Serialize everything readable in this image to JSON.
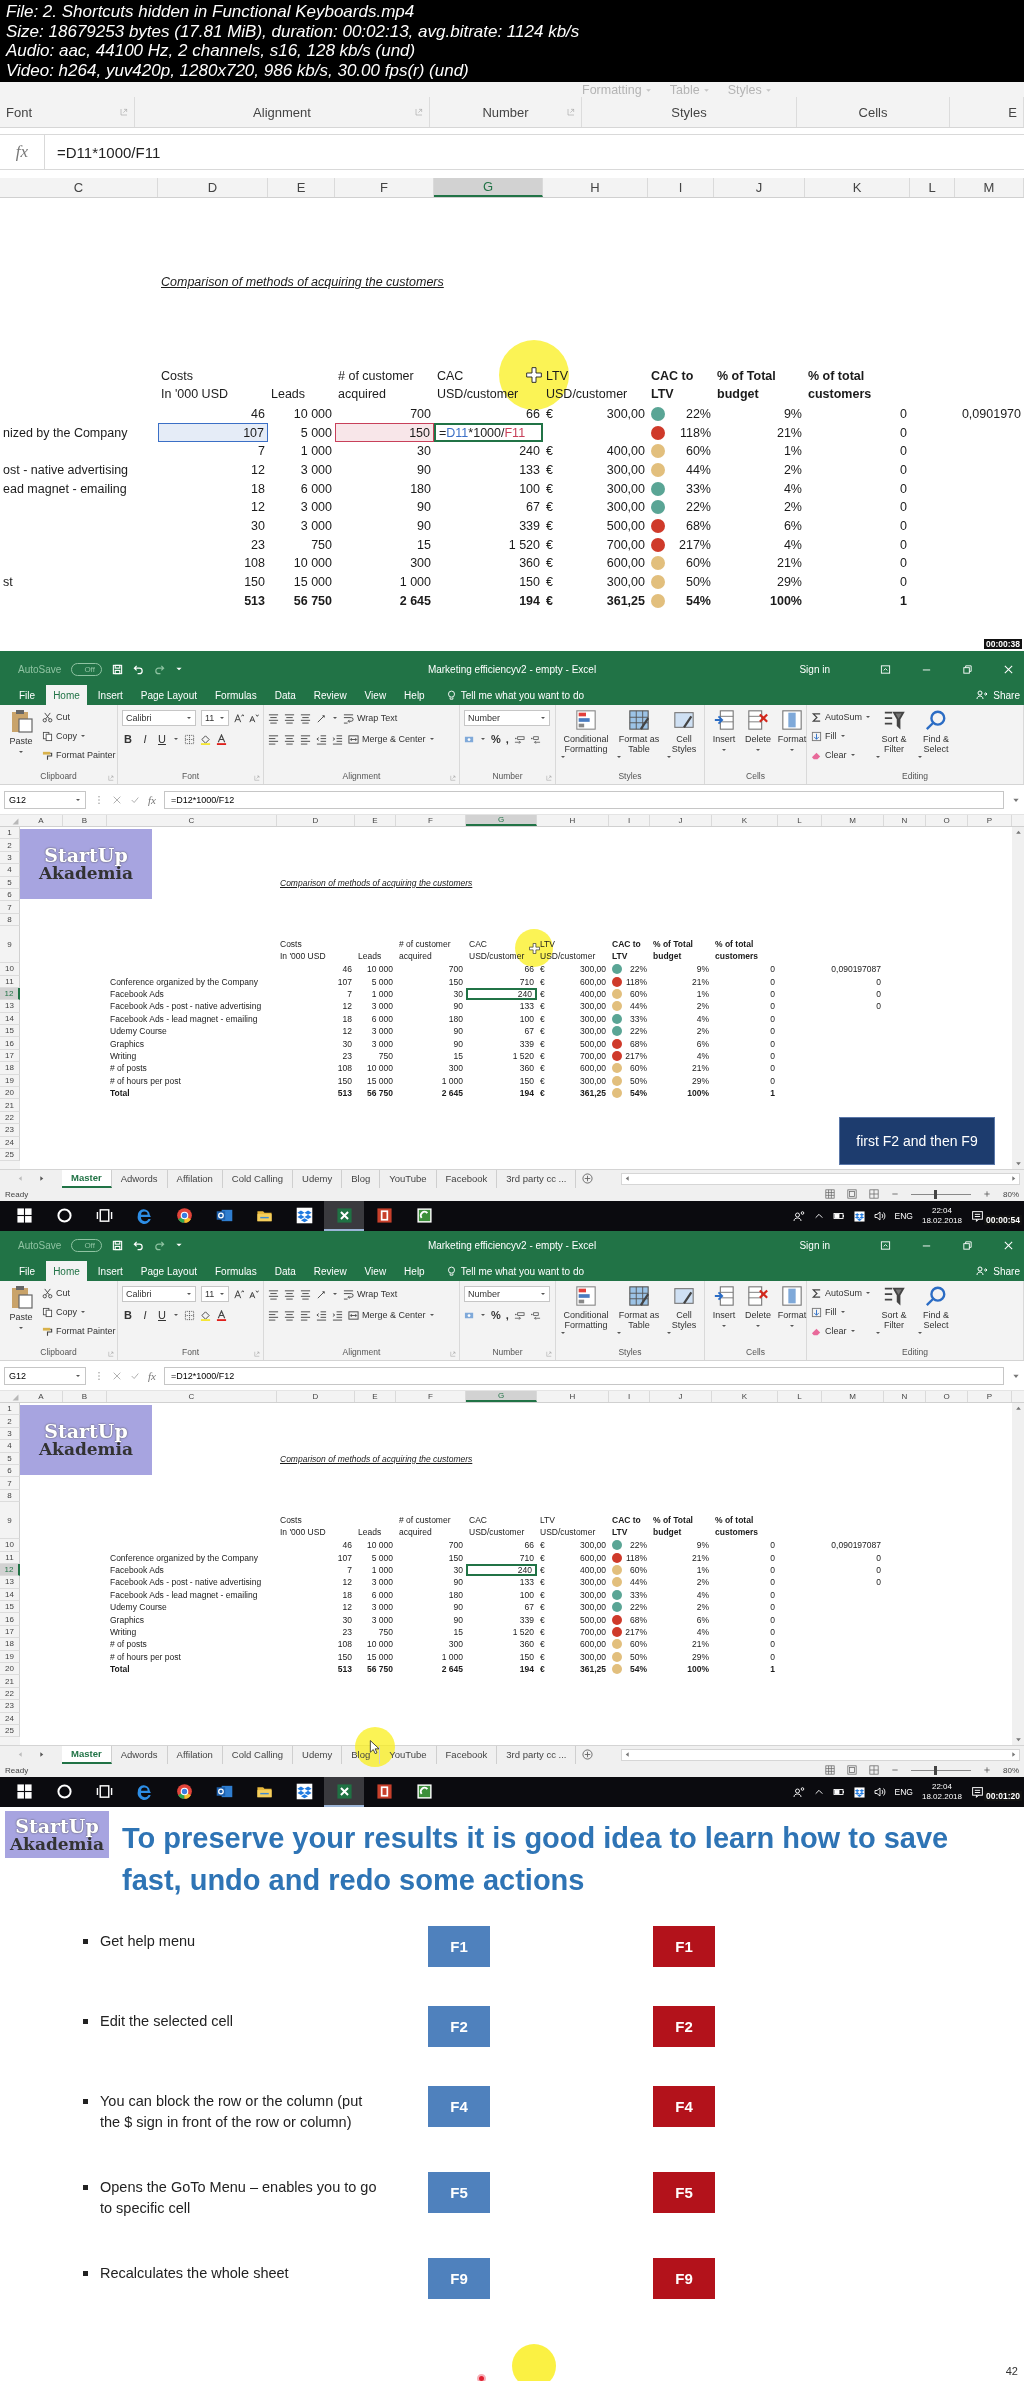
{
  "video_info": [
    "File: 2. Shortcuts hidden in Functional Keyboards.mp4",
    "Size: 18679253 bytes (17.81 MiB), duration: 00:02:13, avg.bitrate: 1124 kb/s",
    "Audio: aac, 44100 Hz, 2 channels, s16, 128 kb/s (und)",
    "Video: h264, yuv420p, 1280x720, 986 kb/s, 30.00 fps(r) (und)"
  ],
  "zoomed_frame": {
    "ribbon_top": [
      "Formatting",
      "Table",
      "Styles"
    ],
    "ribbon_groups": [
      "Font",
      "Alignment",
      "Number",
      "Styles",
      "Cells",
      "E"
    ],
    "formula_label": "fx",
    "formula": "=D11*1000/F11",
    "sheet": {
      "columns": [
        {
          "label": "C",
          "selected": false
        },
        {
          "label": "D",
          "selected": false
        },
        {
          "label": "E",
          "selected": false
        },
        {
          "label": "F",
          "selected": false
        },
        {
          "label": "G",
          "selected": true
        },
        {
          "label": "H",
          "selected": false
        },
        {
          "label": "I",
          "selected": false
        },
        {
          "label": "J",
          "selected": false
        },
        {
          "label": "K",
          "selected": false
        },
        {
          "label": "L",
          "selected": false
        },
        {
          "label": "M",
          "selected": false
        }
      ],
      "title": "Comparison of methods of acquiring the customers",
      "headers": {
        "D": {
          "lines": [
            "Costs",
            "In '000 USD"
          ],
          "bold": false
        },
        "E": {
          "lines": [
            "Leads"
          ],
          "bold": false
        },
        "F": {
          "lines": [
            "# of customer",
            "acquired"
          ],
          "bold": false
        },
        "G": {
          "lines": [
            "CAC",
            "USD/customer"
          ],
          "bold": false
        },
        "H": {
          "lines": [
            "LTV",
            "USD/customer"
          ],
          "bold": false
        },
        "I": {
          "lines": [
            "CAC to",
            "LTV"
          ],
          "bold": true
        },
        "J": {
          "lines": [
            "% of Total",
            "budget"
          ],
          "bold": true
        },
        "K": {
          "lines": [
            "% of total",
            "customers"
          ],
          "bold": true
        }
      },
      "rows": [
        {
          "kind": "data",
          "cells": {
            "D": "46",
            "E": "10 000",
            "F": "700",
            "G": "66",
            "H": "300,00",
            "I": "22%",
            "J": "9%",
            "K": "0",
            "M": "0,0901970"
          },
          "currency": "€",
          "color": "#5aa595"
        },
        {
          "kind": "data",
          "label": "nized by the Company",
          "cells": {
            "D": "107",
            "E": "5 000",
            "F": "150",
            "I": "118%",
            "J": "21%",
            "K": "0"
          },
          "color": "#cf3a2a",
          "selection": {
            "G": true
          },
          "ref_cells": {
            "D": {
              "color": "#3b6fc6"
            },
            "F": {
              "color": "#c8405a"
            }
          },
          "formula_edit": [
            {
              "text": "=",
              "color": "#222222"
            },
            {
              "text": "D11",
              "color": "#3b6fc6"
            },
            {
              "text": "*1000/",
              "color": "#222222"
            },
            {
              "text": "F11",
              "color": "#c8405a"
            }
          ]
        },
        {
          "kind": "data",
          "cells": {
            "D": "7",
            "E": "1 000",
            "F": "30",
            "G": "240",
            "H": "400,00",
            "I": "60%",
            "J": "1%",
            "K": "0"
          },
          "currency": "€",
          "color": "#e2bf7d"
        },
        {
          "kind": "data",
          "label": "ost - native advertising",
          "cells": {
            "D": "12",
            "E": "3 000",
            "F": "90",
            "G": "133",
            "H": "300,00",
            "I": "44%",
            "J": "2%",
            "K": "0"
          },
          "currency": "€",
          "color": "#e2bf7d"
        },
        {
          "kind": "data",
          "label": "ead magnet - emailing",
          "cells": {
            "D": "18",
            "E": "6 000",
            "F": "180",
            "G": "100",
            "H": "300,00",
            "I": "33%",
            "J": "4%",
            "K": "0"
          },
          "currency": "€",
          "color": "#5aa595"
        },
        {
          "kind": "data",
          "cells": {
            "D": "12",
            "E": "3 000",
            "F": "90",
            "G": "67",
            "H": "300,00",
            "I": "22%",
            "J": "2%",
            "K": "0"
          },
          "currency": "€",
          "color": "#5aa595"
        },
        {
          "kind": "data",
          "cells": {
            "D": "30",
            "E": "3 000",
            "F": "90",
            "G": "339",
            "H": "500,00",
            "I": "68%",
            "J": "6%",
            "K": "0"
          },
          "currency": "€",
          "color": "#cf3a2a"
        },
        {
          "kind": "data",
          "cells": {
            "D": "23",
            "E": "750",
            "F": "15",
            "G": "1 520",
            "H": "700,00",
            "I": "217%",
            "J": "4%",
            "K": "0"
          },
          "currency": "€",
          "color": "#cf3a2a"
        },
        {
          "kind": "data",
          "cells": {
            "D": "108",
            "E": "10 000",
            "F": "300",
            "G": "360",
            "H": "600,00",
            "I": "60%",
            "J": "21%",
            "K": "0"
          },
          "currency": "€",
          "color": "#e2bf7d"
        },
        {
          "kind": "data",
          "label": "st",
          "cells": {
            "D": "150",
            "E": "15 000",
            "F": "1 000",
            "G": "150",
            "H": "300,00",
            "I": "50%",
            "J": "29%",
            "K": "0"
          },
          "currency": "€",
          "color": "#e2bf7d"
        },
        {
          "kind": "total",
          "cells": {
            "D": "513",
            "E": "56 750",
            "F": "2 645",
            "G": "194",
            "H": "361,25",
            "I": "54%",
            "J": "100%",
            "K": "1"
          },
          "currency": "€",
          "color": "#e2bf7d"
        }
      ]
    },
    "cursor": {
      "kind": "cross"
    },
    "timestamp": "00:00:38"
  },
  "excel_frames": [
    {
      "autosave": "AutoSave",
      "autosave_state": "Off",
      "title": "Marketing efficiencyv2 - empty - Excel",
      "sign_in": "Sign in",
      "tabs": [
        {
          "label": "File",
          "selected": false
        },
        {
          "label": "Home",
          "selected": true
        },
        {
          "label": "Insert",
          "selected": false
        },
        {
          "label": "Page Layout",
          "selected": false
        },
        {
          "label": "Formulas",
          "selected": false
        },
        {
          "label": "Data",
          "selected": false
        },
        {
          "label": "Review",
          "selected": false
        },
        {
          "label": "View",
          "selected": false
        },
        {
          "label": "Help",
          "selected": false
        }
      ],
      "tell_me": "Tell me what you want to do",
      "share": "Share",
      "ribbon": [
        {
          "kind": "clipboard",
          "label": "Clipboard",
          "big": "Paste",
          "small": [
            "Cut",
            "Copy",
            "Format Painter"
          ]
        },
        {
          "kind": "font",
          "label": "Font",
          "font": "Calibri",
          "size": "11",
          "styles": [
            "B",
            "I",
            "U"
          ]
        },
        {
          "kind": "alignment",
          "label": "Alignment",
          "buttons": [
            "Wrap Text",
            "Merge & Center"
          ]
        },
        {
          "kind": "number",
          "label": "Number",
          "format": "Number",
          "symbols": [
            "%",
            ","
          ]
        },
        {
          "kind": "styles",
          "label": "Styles",
          "big": [
            "Conditional Formatting",
            "Format as Table",
            "Cell Styles"
          ]
        },
        {
          "kind": "cells",
          "label": "Cells",
          "big": [
            "Insert",
            "Delete",
            "Format"
          ]
        },
        {
          "kind": "editing",
          "label": "Editing",
          "small": [
            "AutoSum",
            "Fill",
            "Clear"
          ],
          "big": [
            "Sort & Filter",
            "Find & Select"
          ]
        }
      ],
      "name_box": "G12",
      "formula_label": "fx",
      "formula": "=D12*1000/F12",
      "sheet": {
        "columns": [
          {
            "label": "A",
            "selected": false
          },
          {
            "label": "B",
            "selected": false
          },
          {
            "label": "C",
            "selected": false
          },
          {
            "label": "D",
            "selected": false
          },
          {
            "label": "E",
            "selected": false
          },
          {
            "label": "F",
            "selected": false
          },
          {
            "label": "G",
            "selected": true
          },
          {
            "label": "H",
            "selected": false
          },
          {
            "label": "I",
            "selected": false
          },
          {
            "label": "J",
            "selected": false
          },
          {
            "label": "K",
            "selected": false
          },
          {
            "label": "L",
            "selected": false
          },
          {
            "label": "M",
            "selected": false
          },
          {
            "label": "N",
            "selected": false
          },
          {
            "label": "O",
            "selected": false
          },
          {
            "label": "P",
            "selected": false
          }
        ],
        "row_numbers": [
          {
            "label": "1",
            "selected": false
          },
          {
            "label": "2",
            "selected": false
          },
          {
            "label": "3",
            "selected": false
          },
          {
            "label": "4",
            "selected": false
          },
          {
            "label": "5",
            "selected": false
          },
          {
            "label": "6",
            "selected": false
          },
          {
            "label": "7",
            "selected": false
          },
          {
            "label": "8",
            "selected": false
          },
          {
            "label": "9",
            "selected": false
          },
          {
            "label": "10",
            "selected": false
          },
          {
            "label": "11",
            "selected": false
          },
          {
            "label": "12",
            "selected": true
          },
          {
            "label": "13",
            "selected": false
          },
          {
            "label": "14",
            "selected": false
          },
          {
            "label": "15",
            "selected": false
          },
          {
            "label": "16",
            "selected": false
          },
          {
            "label": "17",
            "selected": false
          },
          {
            "label": "18",
            "selected": false
          },
          {
            "label": "19",
            "selected": false
          },
          {
            "label": "20",
            "selected": false
          },
          {
            "label": "21",
            "selected": false
          },
          {
            "label": "22",
            "selected": false
          },
          {
            "label": "23",
            "selected": false
          },
          {
            "label": "24",
            "selected": false
          },
          {
            "label": "25",
            "selected": false
          }
        ],
        "logo": [
          "StartUp",
          "Akademia"
        ],
        "title": "Comparison of methods of acquiring the customers",
        "headers": {
          "D": {
            "lines": [
              "Costs",
              "In '000 USD"
            ],
            "bold": false
          },
          "E": {
            "lines": [
              "Leads"
            ],
            "bold": false
          },
          "F": {
            "lines": [
              "# of customer",
              "acquired"
            ],
            "bold": false
          },
          "G": {
            "lines": [
              "CAC",
              "USD/customer"
            ],
            "bold": false
          },
          "H": {
            "lines": [
              "LTV",
              "USD/customer"
            ],
            "bold": false
          },
          "I": {
            "lines": [
              "CAC to",
              "LTV"
            ],
            "bold": true
          },
          "J": {
            "lines": [
              "% of Total",
              "budget"
            ],
            "bold": true
          },
          "K": {
            "lines": [
              "% of total",
              "customers"
            ],
            "bold": true
          }
        },
        "rows": [
          {
            "kind": "data",
            "cells": {
              "D": "46",
              "E": "10 000",
              "F": "700",
              "G": "66",
              "H": "300,00",
              "I": "22%",
              "J": "9%",
              "K": "0",
              "M": "0,090197087"
            },
            "currency": "€",
            "color": "#5aa595"
          },
          {
            "kind": "data",
            "label": "Conference organized by the Company",
            "cells": {
              "D": "107",
              "E": "5 000",
              "F": "150",
              "G": "710",
              "H": "600,00",
              "I": "118%",
              "J": "21%",
              "K": "0",
              "M": "0"
            },
            "currency": "€",
            "color": "#cf3a2a"
          },
          {
            "kind": "data",
            "label": "Facebook Ads",
            "cells": {
              "D": "7",
              "E": "1 000",
              "F": "30",
              "G": "240",
              "H": "400,00",
              "I": "60%",
              "J": "1%",
              "K": "0",
              "M": "0"
            },
            "currency": "€",
            "color": "#e2bf7d",
            "selection": {
              "G": true
            }
          },
          {
            "kind": "data",
            "label": "Facebook Ads - post - native advertising",
            "cells": {
              "D": "12",
              "E": "3 000",
              "F": "90",
              "G": "133",
              "H": "300,00",
              "I": "44%",
              "J": "2%",
              "K": "0",
              "M": "0"
            },
            "currency": "€",
            "color": "#e2bf7d"
          },
          {
            "kind": "data",
            "label": "Facebook Ads - lead magnet - emailing",
            "cells": {
              "D": "18",
              "E": "6 000",
              "F": "180",
              "G": "100",
              "H": "300,00",
              "I": "33%",
              "J": "4%",
              "K": "0"
            },
            "currency": "€",
            "color": "#5aa595"
          },
          {
            "kind": "data",
            "label": "Udemy Course",
            "cells": {
              "D": "12",
              "E": "3 000",
              "F": "90",
              "G": "67",
              "H": "300,00",
              "I": "22%",
              "J": "2%",
              "K": "0"
            },
            "currency": "€",
            "color": "#5aa595"
          },
          {
            "kind": "data",
            "label": "Graphics",
            "cells": {
              "D": "30",
              "E": "3 000",
              "F": "90",
              "G": "339",
              "H": "500,00",
              "I": "68%",
              "J": "6%",
              "K": "0"
            },
            "currency": "€",
            "color": "#cf3a2a"
          },
          {
            "kind": "data",
            "label": "Writing",
            "cells": {
              "D": "23",
              "E": "750",
              "F": "15",
              "G": "1 520",
              "H": "700,00",
              "I": "217%",
              "J": "4%",
              "K": "0"
            },
            "currency": "€",
            "color": "#cf3a2a"
          },
          {
            "kind": "data",
            "label": "# of posts",
            "cells": {
              "D": "108",
              "E": "10 000",
              "F": "300",
              "G": "360",
              "H": "600,00",
              "I": "60%",
              "J": "21%",
              "K": "0"
            },
            "currency": "€",
            "color": "#e2bf7d"
          },
          {
            "kind": "data",
            "label": "# of hours per post",
            "cells": {
              "D": "150",
              "E": "15 000",
              "F": "1 000",
              "G": "150",
              "H": "300,00",
              "I": "50%",
              "J": "29%",
              "K": "0"
            },
            "currency": "€",
            "color": "#e2bf7d"
          },
          {
            "kind": "total",
            "label": "Total",
            "cells": {
              "D": "513",
              "E": "56 750",
              "F": "2 645",
              "G": "194",
              "H": "361,25",
              "I": "54%",
              "J": "100%",
              "K": "1"
            },
            "currency": "€",
            "color": "#e2bf7d"
          }
        ]
      },
      "sheet_tabs": [
        {
          "label": "Master",
          "selected": true
        },
        {
          "label": "Adwords",
          "selected": false
        },
        {
          "label": "Affilation",
          "selected": false
        },
        {
          "label": "Cold Calling",
          "selected": false
        },
        {
          "label": "Udemy",
          "selected": false
        },
        {
          "label": "Blog",
          "selected": false
        },
        {
          "label": "YouTube",
          "selected": false
        },
        {
          "label": "Facebook",
          "selected": false
        },
        {
          "label": "3rd party cc ...",
          "selected": false
        }
      ],
      "status": "Ready",
      "zoom": {
        "level": 0.4,
        "reading": "80%"
      },
      "callout": "first F2 and then F9",
      "cursor": {
        "kind": "cross"
      },
      "taskbar": {
        "apps": [
          {
            "kind": "windows",
            "selected": false
          },
          {
            "kind": "circle",
            "selected": false
          },
          {
            "kind": "taskview",
            "selected": false
          },
          {
            "kind": "e-browser",
            "selected": false
          },
          {
            "kind": "round-browser",
            "selected": false
          },
          {
            "kind": "mail",
            "selected": false
          },
          {
            "kind": "folder",
            "selected": false
          },
          {
            "kind": "box",
            "selected": false
          },
          {
            "kind": "spreadsheet",
            "selected": true
          },
          {
            "kind": "presentation",
            "selected": false
          },
          {
            "kind": "recorder",
            "selected": false
          }
        ],
        "language": "ENG",
        "time": "22:04",
        "date": "18.02.2018"
      },
      "timestamp": "00:00:54"
    },
    {
      "autosave": "AutoSave",
      "autosave_state": "Off",
      "title": "Marketing efficiencyv2 - empty - Excel",
      "sign_in": "Sign in",
      "tabs": [
        {
          "label": "File",
          "selected": false
        },
        {
          "label": "Home",
          "selected": true
        },
        {
          "label": "Insert",
          "selected": false
        },
        {
          "label": "Page Layout",
          "selected": false
        },
        {
          "label": "Formulas",
          "selected": false
        },
        {
          "label": "Data",
          "selected": false
        },
        {
          "label": "Review",
          "selected": false
        },
        {
          "label": "View",
          "selected": false
        },
        {
          "label": "Help",
          "selected": false
        }
      ],
      "tell_me": "Tell me what you want to do",
      "share": "Share",
      "ribbon": [
        {
          "kind": "clipboard",
          "label": "Clipboard",
          "big": "Paste",
          "small": [
            "Cut",
            "Copy",
            "Format Painter"
          ]
        },
        {
          "kind": "font",
          "label": "Font",
          "font": "Calibri",
          "size": "11",
          "styles": [
            "B",
            "I",
            "U"
          ]
        },
        {
          "kind": "alignment",
          "label": "Alignment",
          "buttons": [
            "Wrap Text",
            "Merge & Center"
          ]
        },
        {
          "kind": "number",
          "label": "Number",
          "format": "Number",
          "symbols": [
            "%",
            ","
          ]
        },
        {
          "kind": "styles",
          "label": "Styles",
          "big": [
            "Conditional Formatting",
            "Format as Table",
            "Cell Styles"
          ]
        },
        {
          "kind": "cells",
          "label": "Cells",
          "big": [
            "Insert",
            "Delete",
            "Format"
          ]
        },
        {
          "kind": "editing",
          "label": "Editing",
          "small": [
            "AutoSum",
            "Fill",
            "Clear"
          ],
          "big": [
            "Sort & Filter",
            "Find & Select"
          ]
        }
      ],
      "name_box": "G12",
      "formula_label": "fx",
      "formula": "=D12*1000/F12",
      "sheet": {
        "columns": [
          {
            "label": "A",
            "selected": false
          },
          {
            "label": "B",
            "selected": false
          },
          {
            "label": "C",
            "selected": false
          },
          {
            "label": "D",
            "selected": false
          },
          {
            "label": "E",
            "selected": false
          },
          {
            "label": "F",
            "selected": false
          },
          {
            "label": "G",
            "selected": true
          },
          {
            "label": "H",
            "selected": false
          },
          {
            "label": "I",
            "selected": false
          },
          {
            "label": "J",
            "selected": false
          },
          {
            "label": "K",
            "selected": false
          },
          {
            "label": "L",
            "selected": false
          },
          {
            "label": "M",
            "selected": false
          },
          {
            "label": "N",
            "selected": false
          },
          {
            "label": "O",
            "selected": false
          },
          {
            "label": "P",
            "selected": false
          }
        ],
        "row_numbers": [
          {
            "label": "1",
            "selected": false
          },
          {
            "label": "2",
            "selected": false
          },
          {
            "label": "3",
            "selected": false
          },
          {
            "label": "4",
            "selected": false
          },
          {
            "label": "5",
            "selected": false
          },
          {
            "label": "6",
            "selected": false
          },
          {
            "label": "7",
            "selected": false
          },
          {
            "label": "8",
            "selected": false
          },
          {
            "label": "9",
            "selected": false
          },
          {
            "label": "10",
            "selected": false
          },
          {
            "label": "11",
            "selected": false
          },
          {
            "label": "12",
            "selected": true
          },
          {
            "label": "13",
            "selected": false
          },
          {
            "label": "14",
            "selected": false
          },
          {
            "label": "15",
            "selected": false
          },
          {
            "label": "16",
            "selected": false
          },
          {
            "label": "17",
            "selected": false
          },
          {
            "label": "18",
            "selected": false
          },
          {
            "label": "19",
            "selected": false
          },
          {
            "label": "20",
            "selected": false
          },
          {
            "label": "21",
            "selected": false
          },
          {
            "label": "22",
            "selected": false
          },
          {
            "label": "23",
            "selected": false
          },
          {
            "label": "24",
            "selected": false
          },
          {
            "label": "25",
            "selected": false
          }
        ],
        "logo": [
          "StartUp",
          "Akademia"
        ],
        "title": "Comparison of methods of acquiring the customers",
        "headers": {
          "D": {
            "lines": [
              "Costs",
              "In '000 USD"
            ],
            "bold": false
          },
          "E": {
            "lines": [
              "Leads"
            ],
            "bold": false
          },
          "F": {
            "lines": [
              "# of customer",
              "acquired"
            ],
            "bold": false
          },
          "G": {
            "lines": [
              "CAC",
              "USD/customer"
            ],
            "bold": false
          },
          "H": {
            "lines": [
              "LTV",
              "USD/customer"
            ],
            "bold": false
          },
          "I": {
            "lines": [
              "CAC to",
              "LTV"
            ],
            "bold": true
          },
          "J": {
            "lines": [
              "% of Total",
              "budget"
            ],
            "bold": true
          },
          "K": {
            "lines": [
              "% of total",
              "customers"
            ],
            "bold": true
          }
        },
        "rows": [
          {
            "kind": "data",
            "cells": {
              "D": "46",
              "E": "10 000",
              "F": "700",
              "G": "66",
              "H": "300,00",
              "I": "22%",
              "J": "9%",
              "K": "0",
              "M": "0,090197087"
            },
            "currency": "€",
            "color": "#5aa595"
          },
          {
            "kind": "data",
            "label": "Conference organized by the Company",
            "cells": {
              "D": "107",
              "E": "5 000",
              "F": "150",
              "G": "710",
              "H": "600,00",
              "I": "118%",
              "J": "21%",
              "K": "0",
              "M": "0"
            },
            "currency": "€",
            "color": "#cf3a2a"
          },
          {
            "kind": "data",
            "label": "Facebook Ads",
            "cells": {
              "D": "7",
              "E": "1 000",
              "F": "30",
              "G": "240",
              "H": "400,00",
              "I": "60%",
              "J": "1%",
              "K": "0",
              "M": "0"
            },
            "currency": "€",
            "color": "#e2bf7d",
            "selection": {
              "G": true
            }
          },
          {
            "kind": "data",
            "label": "Facebook Ads - post - native advertising",
            "cells": {
              "D": "12",
              "E": "3 000",
              "F": "90",
              "G": "133",
              "H": "300,00",
              "I": "44%",
              "J": "2%",
              "K": "0",
              "M": "0"
            },
            "currency": "€",
            "color": "#e2bf7d"
          },
          {
            "kind": "data",
            "label": "Facebook Ads - lead magnet - emailing",
            "cells": {
              "D": "18",
              "E": "6 000",
              "F": "180",
              "G": "100",
              "H": "300,00",
              "I": "33%",
              "J": "4%",
              "K": "0"
            },
            "currency": "€",
            "color": "#5aa595"
          },
          {
            "kind": "data",
            "label": "Udemy Course",
            "cells": {
              "D": "12",
              "E": "3 000",
              "F": "90",
              "G": "67",
              "H": "300,00",
              "I": "22%",
              "J": "2%",
              "K": "0"
            },
            "currency": "€",
            "color": "#5aa595"
          },
          {
            "kind": "data",
            "label": "Graphics",
            "cells": {
              "D": "30",
              "E": "3 000",
              "F": "90",
              "G": "339",
              "H": "500,00",
              "I": "68%",
              "J": "6%",
              "K": "0"
            },
            "currency": "€",
            "color": "#cf3a2a"
          },
          {
            "kind": "data",
            "label": "Writing",
            "cells": {
              "D": "23",
              "E": "750",
              "F": "15",
              "G": "1 520",
              "H": "700,00",
              "I": "217%",
              "J": "4%",
              "K": "0"
            },
            "currency": "€",
            "color": "#cf3a2a"
          },
          {
            "kind": "data",
            "label": "# of posts",
            "cells": {
              "D": "108",
              "E": "10 000",
              "F": "300",
              "G": "360",
              "H": "600,00",
              "I": "60%",
              "J": "21%",
              "K": "0"
            },
            "currency": "€",
            "color": "#e2bf7d"
          },
          {
            "kind": "data",
            "label": "# of hours per post",
            "cells": {
              "D": "150",
              "E": "15 000",
              "F": "1 000",
              "G": "150",
              "H": "300,00",
              "I": "50%",
              "J": "29%",
              "K": "0"
            },
            "currency": "€",
            "color": "#e2bf7d"
          },
          {
            "kind": "total",
            "label": "Total",
            "cells": {
              "D": "513",
              "E": "56 750",
              "F": "2 645",
              "G": "194",
              "H": "361,25",
              "I": "54%",
              "J": "100%",
              "K": "1"
            },
            "currency": "€",
            "color": "#e2bf7d"
          }
        ]
      },
      "sheet_tabs": [
        {
          "label": "Master",
          "selected": true
        },
        {
          "label": "Adwords",
          "selected": false
        },
        {
          "label": "Affilation",
          "selected": false
        },
        {
          "label": "Cold Calling",
          "selected": false
        },
        {
          "label": "Udemy",
          "selected": false
        },
        {
          "label": "Blog",
          "selected": false
        },
        {
          "label": "YouTube",
          "selected": false
        },
        {
          "label": "Facebook",
          "selected": false
        },
        {
          "label": "3rd party cc ...",
          "selected": false
        }
      ],
      "status": "Ready",
      "zoom": {
        "level": 0.4,
        "reading": "80%"
      },
      "cursor": {
        "kind": "arrow"
      },
      "taskbar": {
        "apps": [
          {
            "kind": "windows",
            "selected": false
          },
          {
            "kind": "circle",
            "selected": false
          },
          {
            "kind": "taskview",
            "selected": false
          },
          {
            "kind": "e-browser",
            "selected": false
          },
          {
            "kind": "round-browser",
            "selected": false
          },
          {
            "kind": "mail",
            "selected": false
          },
          {
            "kind": "folder",
            "selected": false
          },
          {
            "kind": "box",
            "selected": false
          },
          {
            "kind": "spreadsheet",
            "selected": true
          },
          {
            "kind": "presentation",
            "selected": false
          },
          {
            "kind": "recorder",
            "selected": false
          }
        ],
        "language": "ENG",
        "time": "22:04",
        "date": "18.02.2018"
      },
      "timestamp": "00:01:20"
    }
  ],
  "slide": {
    "logo": [
      "StartUp",
      "Akademia"
    ],
    "title": "To preserve your results it is good idea to learn how to save fast, undo and redo some actions",
    "items": [
      {
        "text": "Get help menu",
        "keys": [
          {
            "label": "F1",
            "color": "#4f81bd"
          },
          {
            "label": "F1",
            "color": "#b3121b"
          }
        ]
      },
      {
        "text": "Edit the selected cell",
        "keys": [
          {
            "label": "F2",
            "color": "#4f81bd"
          },
          {
            "label": "F2",
            "color": "#b3121b"
          }
        ]
      },
      {
        "text": "You can block the row or the column (put the $ sign in front of the row or column)",
        "keys": [
          {
            "label": "F4",
            "color": "#4f81bd"
          },
          {
            "label": "F4",
            "color": "#b3121b"
          }
        ]
      },
      {
        "text": "Opens the GoTo Menu – enables you to go to specific cell",
        "keys": [
          {
            "label": "F5",
            "color": "#4f81bd"
          },
          {
            "label": "F5",
            "color": "#b3121b"
          }
        ]
      },
      {
        "text": "Recalculates the whole sheet",
        "keys": [
          {
            "label": "F9",
            "color": "#4f81bd"
          },
          {
            "label": "F9",
            "color": "#b3121b"
          }
        ]
      }
    ],
    "page": "42"
  }
}
